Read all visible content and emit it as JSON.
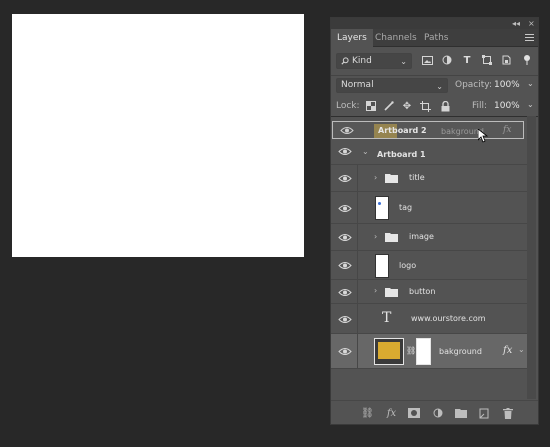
{
  "tabs": [
    {
      "label": "Layers",
      "active": true
    },
    {
      "label": "Channels",
      "active": false
    },
    {
      "label": "Paths",
      "active": false
    }
  ],
  "panel_controls": {
    "collapse": "◂◂",
    "close": "×"
  },
  "filter": {
    "kind_label": "Kind",
    "icons": [
      "image-filter-icon",
      "adjustment-filter-icon",
      "type-filter-icon",
      "shape-filter-icon",
      "smart-object-filter-icon"
    ]
  },
  "mode": {
    "blend": "Normal",
    "opacity_label": "Opacity:",
    "opacity_value": "100%"
  },
  "lock": {
    "label": "Lock:",
    "fill_label": "Fill:",
    "fill_value": "100%"
  },
  "drag_ghost": {
    "label": "Artboard 2",
    "underlay_label": "bakground",
    "fx": "fx"
  },
  "layers": [
    {
      "name": "Artboard 1",
      "type": "artboard"
    },
    {
      "name": "title",
      "type": "group"
    },
    {
      "name": "tag",
      "type": "layer"
    },
    {
      "name": "image",
      "type": "group"
    },
    {
      "name": "logo",
      "type": "layer"
    },
    {
      "name": "button",
      "type": "group"
    },
    {
      "name": "www.ourstore.com",
      "type": "text",
      "glyph": "T"
    },
    {
      "name": "bakground",
      "type": "layer",
      "fx": "fx",
      "thumb_color": "#d9ab30"
    }
  ],
  "colors": {
    "canvas": "#ffffff",
    "panel": "#535353",
    "background": "#282828",
    "accent_swatch": "#d9ab30"
  }
}
